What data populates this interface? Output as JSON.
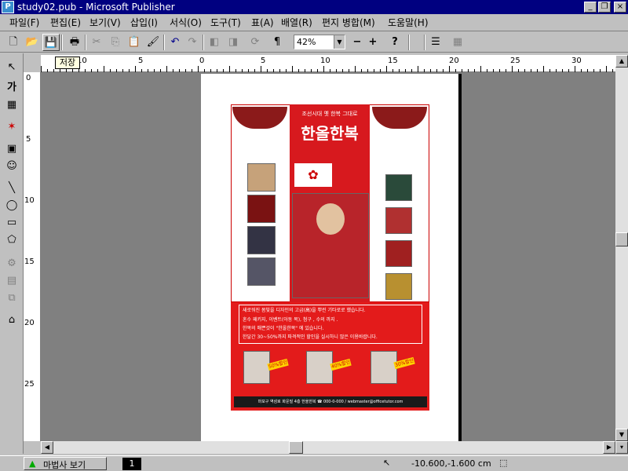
{
  "window": {
    "title": "study02.pub - Microsoft Publisher",
    "app_icon": "publisher-icon",
    "controls": [
      "minimize",
      "restore",
      "close"
    ]
  },
  "menubar": {
    "items": [
      {
        "label": "파일(F)"
      },
      {
        "label": "편집(E)"
      },
      {
        "label": "보기(V)"
      },
      {
        "label": "삽입(I)"
      },
      {
        "label": "서식(O)"
      },
      {
        "label": "도구(T)"
      },
      {
        "label": "표(A)"
      },
      {
        "label": "배열(R)"
      },
      {
        "label": "편지 병합(M)"
      },
      {
        "label": "도움말(H)"
      }
    ]
  },
  "toolbar": {
    "zoom_value": "42%",
    "tooltip": "저장",
    "icons": [
      "new-icon",
      "open-icon",
      "save-icon",
      "print-icon",
      "cut-icon",
      "copy-icon",
      "paste-icon",
      "format-painter-icon",
      "undo-icon",
      "redo-icon",
      "bring-front-icon",
      "send-back-icon",
      "rotate-icon",
      "paragraph-icon",
      "zoom-out-icon",
      "zoom-in-icon",
      "help-icon"
    ]
  },
  "lefttools": {
    "items": [
      "pointer-icon",
      "text-frame-icon",
      "table-frame-icon",
      "wordart-icon",
      "picture-frame-icon",
      "clipart-icon",
      "line-icon",
      "oval-icon",
      "rectangle-icon",
      "custom-shape-icon",
      "ole-icon",
      "form-icon",
      "web-icon",
      "design-gallery-icon"
    ],
    "text_tool_label": "가"
  },
  "ruler": {
    "h_labels": [
      "10",
      "5",
      "0",
      "5",
      "10",
      "15",
      "20",
      "25",
      "30"
    ],
    "v_labels": [
      "0",
      "5",
      "10",
      "15",
      "20",
      "25"
    ]
  },
  "document": {
    "tagline": "조선시대 옛 한복 그대로",
    "brand": "한올한복",
    "body_lines": [
      "새로워진 봄빛을 디자인의 고급(高)을 뿌린 기타로로 했습니다.",
      "혼수 패키지, 이벤트(아동 복), 첨구 , 수의 까지 .",
      "한복의 매쁜것이 \"한올한복\" 에 있습니다.",
      "한달간 30~50%까지 파격적인 할인을 실시하니 많은 이용바랍니다."
    ],
    "tags": [
      "50%할인",
      "40%할인",
      "30%할인"
    ],
    "footer": "마포구 역삼로 화운빌 4층 한올한복 ☎ 000-0-000 / webmaster@officetutor.com"
  },
  "statusbar": {
    "wizard_label": "마법사 보기",
    "page_number": "1",
    "coords": "-10.600,-1.600 cm"
  },
  "colors": {
    "title_bg": "#000080",
    "chrome": "#c0c0c0",
    "ad_red": "#e31b1b",
    "canvas": "#808080"
  }
}
